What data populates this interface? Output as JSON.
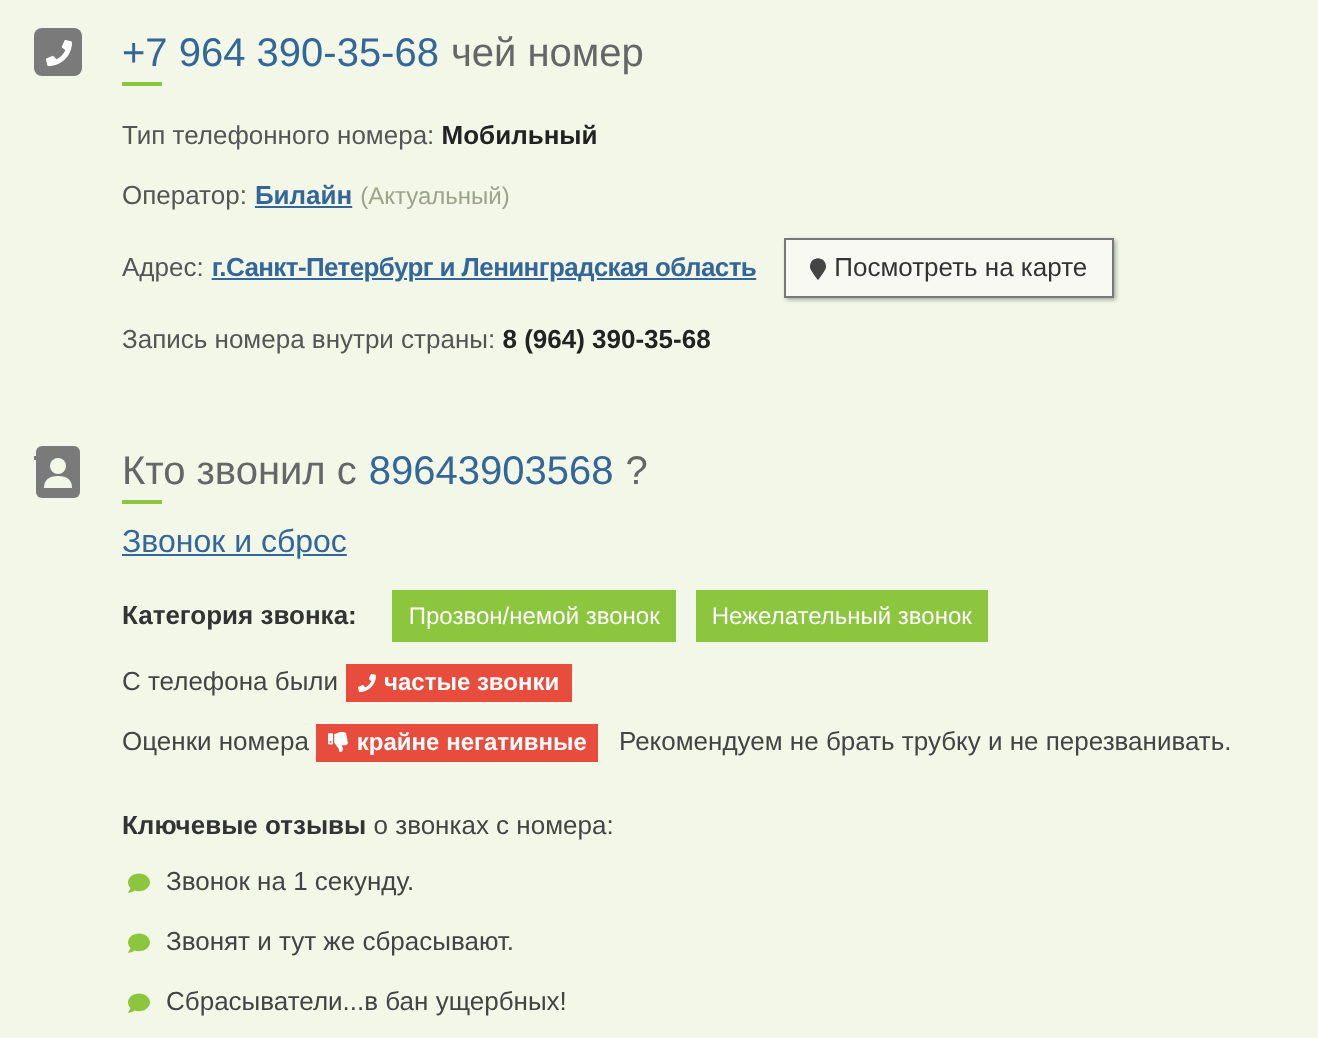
{
  "phone_section": {
    "number": "+7 964 390-35-68",
    "title_suffix": "чей номер",
    "fields": [
      {
        "kind": "text",
        "text": "Тип телефонного номера: **Мобильный**"
      },
      {
        "kind": "link",
        "label": "Оператор:",
        "link": "Билайн",
        "note": "(Актуальный)"
      },
      {
        "kind": "link_button",
        "label": "Адрес:",
        "link": "г.Санкт-Петербург и Ленинградская область",
        "button": "Посмотреть на карте"
      },
      {
        "kind": "text",
        "text": "Запись номера внутри страны: **8 (964) 390-35-68**"
      }
    ]
  },
  "caller_section": {
    "title_prefix": "Кто звонил с",
    "number": "89643903568",
    "title_suffix": "?",
    "link": "Звонок и сброс",
    "category_label": "Категория звонка:",
    "categories": [
      "Прозвон/немой звонок",
      "Нежелательный звонок"
    ],
    "badge_rows": [
      {
        "label": "С телефона были",
        "badge": "частые звонки",
        "kind": "frequency"
      },
      {
        "label": "Оценки номера",
        "badge": "крайне негативные",
        "kind": "rating",
        "advice": "Рекомендуем не брать трубку и не перезванивать."
      }
    ],
    "reviews_heading": "**Ключевые отзывы** о звонках с номера:",
    "reviews": [
      "Звонок на 1 секунду.",
      "Звонят и тут же сбрасывают.",
      "Сбрасыватели...в бан ущербных!"
    ]
  }
}
